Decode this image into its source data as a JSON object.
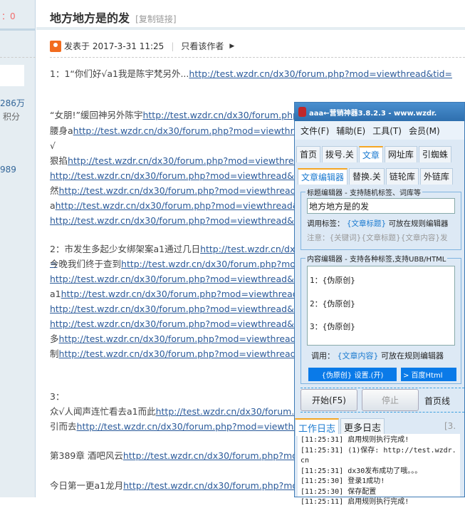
{
  "sidebar": {
    "stat_zero": "：0",
    "count": "286万",
    "points_label": "积分",
    "num": "989"
  },
  "post": {
    "title": "地方地方是的发",
    "copy_link": "[复制链接]",
    "posted": "发表于 2017-3-31 11:25",
    "author_only": "只看该作者",
    "url": "http://test.wzdr.cn/dx30/forum.php?mod=viewthread&tid=",
    "lines": [
      {
        "pre": "1：1“你们好√a1我是陈宇梵另外...",
        "link": true
      },
      {
        "pre": "“女朋!”缓回神另外陈宇",
        "link": true
      },
      {
        "pre": "腰身a",
        "link": true
      },
      {
        "pre": "√",
        "link": false
      },
      {
        "pre": "狠掐",
        "link": true
      },
      {
        "pre": "",
        "link": true
      },
      {
        "pre": "然",
        "link": true
      },
      {
        "pre": "a",
        "link": true
      },
      {
        "pre": "",
        "link": true
      },
      {
        "pre": "2：市发生多起少女绑架案a1通过几日",
        "link": true
      },
      {
        "pre": "今晚我们终于查到",
        "link": true
      },
      {
        "pre": "",
        "link": true
      },
      {
        "pre": "a1",
        "link": true
      },
      {
        "pre": "",
        "link": true
      },
      {
        "pre": "",
        "link": true
      },
      {
        "pre": "多",
        "link": true
      },
      {
        "pre": "制",
        "link": true
      },
      {
        "pre": "3：",
        "link": false
      },
      {
        "pre": "众√人闻声连忙看去a1而此",
        "link": true
      },
      {
        "pre": "引而去",
        "link": true
      },
      {
        "pre": "第389章 酒吧风云",
        "link": true
      },
      {
        "pre": "今日第一更a1龙月",
        "link": true
      }
    ]
  },
  "app": {
    "title": "aaa←营销神器3.8.2.3 - www.wzdr.",
    "menu": [
      "文件(F)",
      "辅助(E)",
      "工具(T)",
      "会员(M)"
    ],
    "tabs": [
      "首页",
      "拨号.关",
      "文章",
      "网址库",
      "引蜘蛛"
    ],
    "subtabs": [
      "文章编辑器",
      "替换.关",
      "链轮库",
      "外链库"
    ],
    "title_group": "标题编辑器 - 支持随机标签、词库等",
    "title_value": "地方地方是的发",
    "call_label": "调用标签：",
    "title_tag": "{文章标题}",
    "place_note": "可放在规则编辑器",
    "notice": "注意：{关键词}{文章标题}{文章内容}发",
    "content_group": "内容编辑器 - 支持各种标签,支持UBB/HTML",
    "content_lines": [
      "1：{伪原创}",
      "2：{伪原创}",
      "3：{伪原创}"
    ],
    "call2": "调用：",
    "content_tag": "{文章内容}",
    "place_note2": "可放在规则编辑器",
    "pseudo_setting": "{伪原创} 设置.(开)",
    "baidu": "> 百度Html",
    "start": "开始(F5)",
    "stop": "停止",
    "home_label": "首页线",
    "log_tabs": [
      "工作日志",
      "更多日志"
    ],
    "log_count": "[3.",
    "log": [
      "[11:25:31] 启用规则执行完成!",
      "[11:25:31] (1)保存: http://test.wzdr.cn",
      "[11:25:31] dx30发布成功了哦。。。",
      "[11:25:30] 登录1成功!",
      "[11:25:30] 保存配置",
      "[11:25:11] 启用规则执行完成!"
    ]
  }
}
